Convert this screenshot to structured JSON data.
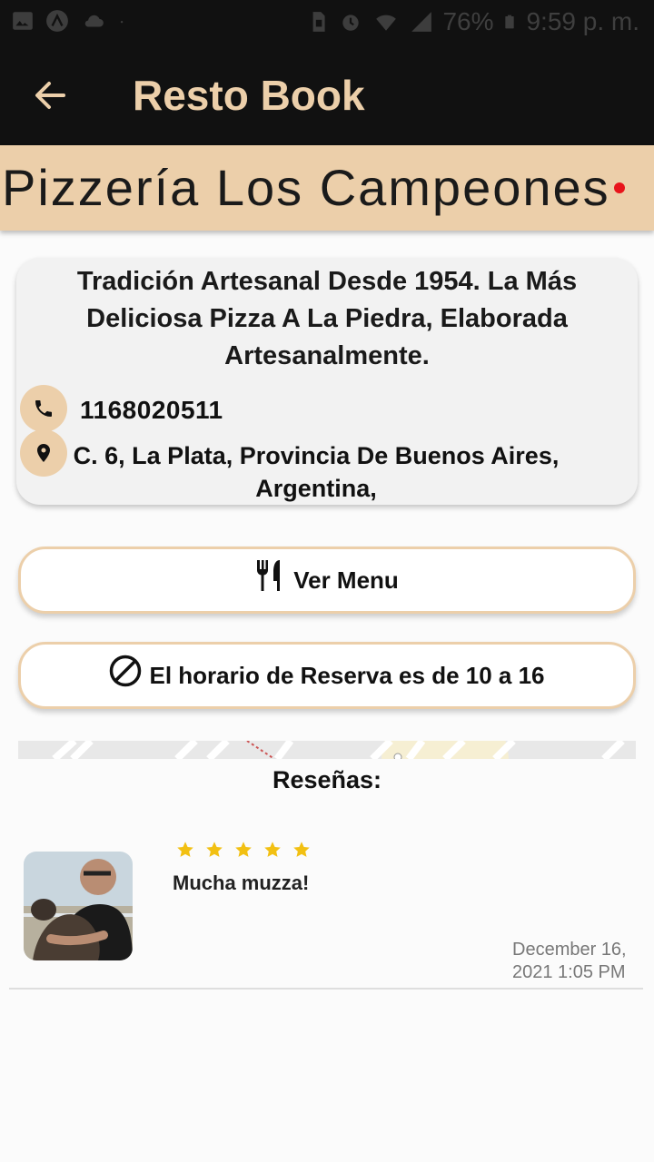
{
  "status_bar": {
    "battery": "76%",
    "time": "9:59 p. m.",
    "icons": [
      "gallery-icon",
      "app-a-icon",
      "cloud-icon",
      "dot-icon",
      "sim-icon",
      "alarm-icon",
      "wifi-icon",
      "signal-icon",
      "battery-icon"
    ]
  },
  "app_bar": {
    "title": "Resto Book",
    "back_icon": "arrow-left-icon"
  },
  "restaurant": {
    "name": "Pizzería Los Campeones",
    "description": "Tradición Artesanal Desde 1954. La Más Deliciosa Pizza A La Piedra, Elaborada Artesanalmente.",
    "phone": "1168020511",
    "address": "C. 6, La Plata, Provincia De Buenos Aires, Argentina,"
  },
  "actions": {
    "menu_label": "Ver Menu",
    "menu_icon": "fork-knife-icon",
    "schedule_label": "El horario de Reserva es de 10 a 16",
    "schedule_icon": "block-icon"
  },
  "reviews": {
    "title": "Reseñas:",
    "items": [
      {
        "rating": 5,
        "text": "Mucha muzza!",
        "date": "December 16, 2021 1:05 PM"
      }
    ]
  },
  "colors": {
    "accent": "#eccfaa",
    "dark": "#111111",
    "star": "#f2c012",
    "card": "#f2f2f2"
  }
}
